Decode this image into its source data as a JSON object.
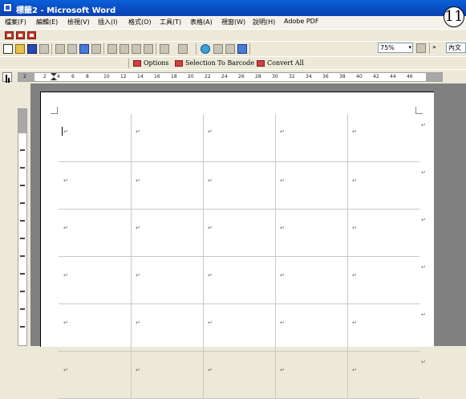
{
  "window": {
    "title": "標籤2 - Microsoft Word",
    "step_badge": "11"
  },
  "menubar": {
    "items": [
      "檔案(F)",
      "編輯(E)",
      "檢視(V)",
      "插入(I)",
      "格式(O)",
      "工具(T)",
      "表格(A)",
      "視窗(W)",
      "說明(H)",
      "Adobe PDF"
    ]
  },
  "toolbar": {
    "zoom": "75%",
    "style": "內文"
  },
  "barcode_toolbar": {
    "options_label": "Options",
    "selection_label": "Selection To Barcode",
    "convert_label": "Convert All"
  },
  "ruler": {
    "ticks": [
      "2",
      "2",
      "4",
      "6",
      "8",
      "10",
      "12",
      "14",
      "16",
      "18",
      "20",
      "22",
      "24",
      "26",
      "28",
      "30",
      "32",
      "34",
      "36",
      "38",
      "40",
      "42",
      "44",
      "46"
    ]
  },
  "document": {
    "paragraph_mark": "↵",
    "columns": 5,
    "rows": 6
  },
  "colors": {
    "titlebar": "#0a4fcf",
    "chrome": "#ece9d8",
    "document_bg": "#808080",
    "barcode_icon": "#d04040"
  }
}
